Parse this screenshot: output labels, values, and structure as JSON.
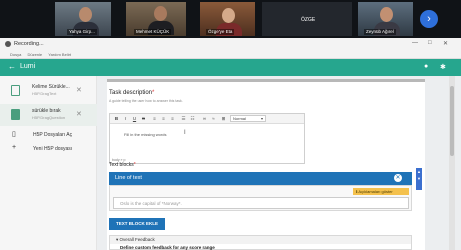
{
  "video": {
    "participants": [
      {
        "name": "Yahya Girp..."
      },
      {
        "name": "Mehmet KÜÇÜK"
      },
      {
        "name": "Özge'ye Eta"
      },
      {
        "name": "ÖZGE"
      },
      {
        "name": "Zeynüb Ağırel"
      }
    ],
    "next_page_icon": "chevron-right-icon"
  },
  "window": {
    "recording_label": "Recording...",
    "menu": [
      "Dosya",
      "Düzenle",
      "Yardım Belirt"
    ],
    "controls": [
      "—",
      "□",
      "✕"
    ]
  },
  "app": {
    "title": "Lumi",
    "colors": {
      "header": "#26a68e",
      "accent": "#1f73b7",
      "important": "#f4c14d"
    }
  },
  "sidebar": {
    "files": [
      {
        "name": "Kelime Sürükle...",
        "subtitle": "H5P.DragText"
      },
      {
        "name": "sürükle bırak",
        "subtitle": "H5P.DragQuestion"
      }
    ],
    "actions": [
      {
        "label": "H5P Dosyaları Aç",
        "icon": "document-icon"
      },
      {
        "label": "Yeni H5P dosyası",
        "icon": "plus-icon"
      }
    ]
  },
  "editor": {
    "task_label": "Task description",
    "task_hint": "A guide telling the user how to answer this task.",
    "format_option": "Normal",
    "body_text": "Fill in the missing words",
    "path_text": "body » p",
    "text_blocks_label": "Text blocks",
    "block_title": "Line of text",
    "show_important_label": "Açıklamaları göster",
    "text_placeholder": "Oslo is the capital of *Norway*.",
    "add_block_label": "TEXT BLOCK EKLE",
    "feedback_title": "Overall Feedback",
    "feedback_sub": "Define custom feedback for any score range"
  }
}
